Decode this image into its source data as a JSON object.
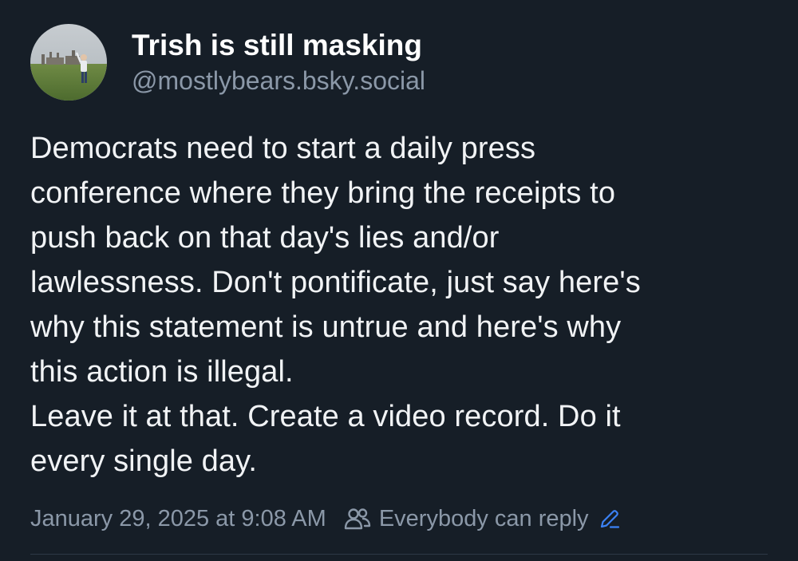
{
  "author": {
    "display_name": "Trish is still masking",
    "handle": "@mostlybears.bsky.social",
    "avatar_icon": "profile-photo"
  },
  "post": {
    "text_lines": [
      "Democrats need to start a daily press",
      "conference where they bring the receipts to",
      "push back on that day's lies and/or",
      "lawlessness. Don't pontificate, just say here's",
      "why this statement is untrue and here's why",
      "this action is illegal.",
      "Leave it at that. Create a video record. Do it",
      "every single day."
    ]
  },
  "meta": {
    "timestamp": "January 29, 2025 at 9:08 AM",
    "reply_setting": "Everybody can reply",
    "reply_icon": "people-icon",
    "edit_icon": "pencil-icon"
  },
  "colors": {
    "background": "#161e27",
    "text_primary": "#ffffff",
    "text_secondary": "#8b98a8",
    "accent": "#3b82f6"
  }
}
